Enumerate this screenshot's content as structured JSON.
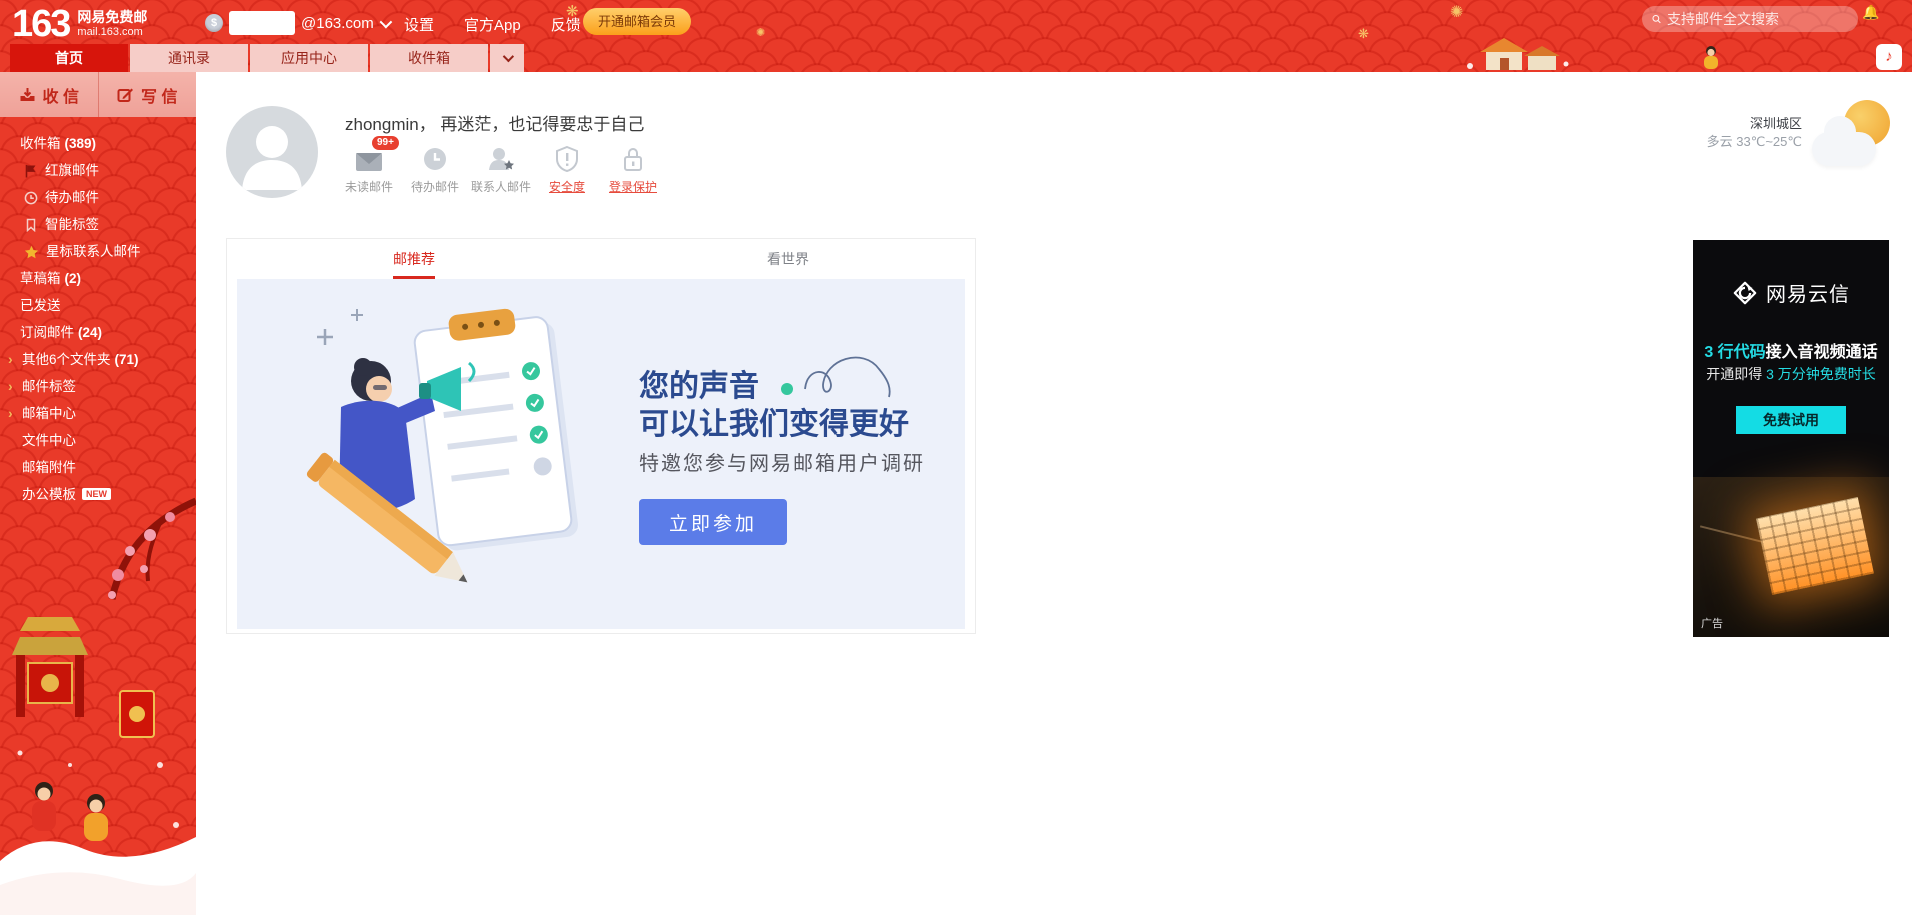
{
  "header": {
    "logo_number": "163",
    "logo_brand": "网易免费邮",
    "logo_domain": "mail.163.com",
    "account": {
      "email_suffix": "@163.com"
    },
    "nav_settings": "设置",
    "nav_app": "官方App",
    "nav_feedback": "反馈",
    "vip_button": "开通邮箱会员",
    "search_placeholder": "支持邮件全文搜索"
  },
  "tabs": {
    "home": "首页",
    "contacts": "通讯录",
    "apps": "应用中心",
    "inbox": "收件箱"
  },
  "sidebar": {
    "receive_mail": "收 信",
    "compose_mail": "写 信",
    "items": [
      {
        "label": "收件箱",
        "count": "(389)"
      },
      {
        "label": "红旗邮件"
      },
      {
        "label": "待办邮件"
      },
      {
        "label": "智能标签"
      },
      {
        "label": "星标联系人邮件"
      },
      {
        "label": "草稿箱",
        "count": "(2)"
      },
      {
        "label": "已发送"
      },
      {
        "label": "订阅邮件",
        "count": "(24)"
      },
      {
        "label": "其他6个文件夹",
        "count": "(71)"
      },
      {
        "label": "邮件标签"
      },
      {
        "label": "邮箱中心"
      },
      {
        "label": "文件中心"
      },
      {
        "label": "邮箱附件"
      },
      {
        "label": "办公模板",
        "badge": "NEW"
      }
    ]
  },
  "profile": {
    "greeting": "zhongmin， 再迷茫，也记得要忠于自己",
    "shortcuts": [
      {
        "label": "未读邮件",
        "badge": "99+"
      },
      {
        "label": "待办邮件"
      },
      {
        "label": "联系人邮件"
      },
      {
        "label": "安全度"
      },
      {
        "label": "登录保护"
      }
    ]
  },
  "weather": {
    "city": "深圳城区",
    "detail": "多云 33℃~25℃"
  },
  "card": {
    "tab_recommend": "邮推荐",
    "tab_world": "看世界",
    "survey": {
      "title_line1": "您的声音",
      "title_line2": "可以让我们变得更好",
      "subtitle": "特邀您参与网易邮箱用户调研",
      "button": "立即参加"
    }
  },
  "ad": {
    "brand": "网易云信",
    "headline_highlight": "3 行代码",
    "headline_rest": "接入音视频通话",
    "subline_prefix": "开通即得 ",
    "subline_highlight": "3 万分钟免费时长",
    "button": "免费试用",
    "tag": "广告"
  },
  "colors": {
    "topbar_red": "#e93a29",
    "active_tab_red": "#d7150c",
    "accent_cyan": "#25dce4",
    "survey_button_blue": "#5b7ce8",
    "headline_navy": "#2b4a8f",
    "vip_gold": "#fba01b"
  }
}
